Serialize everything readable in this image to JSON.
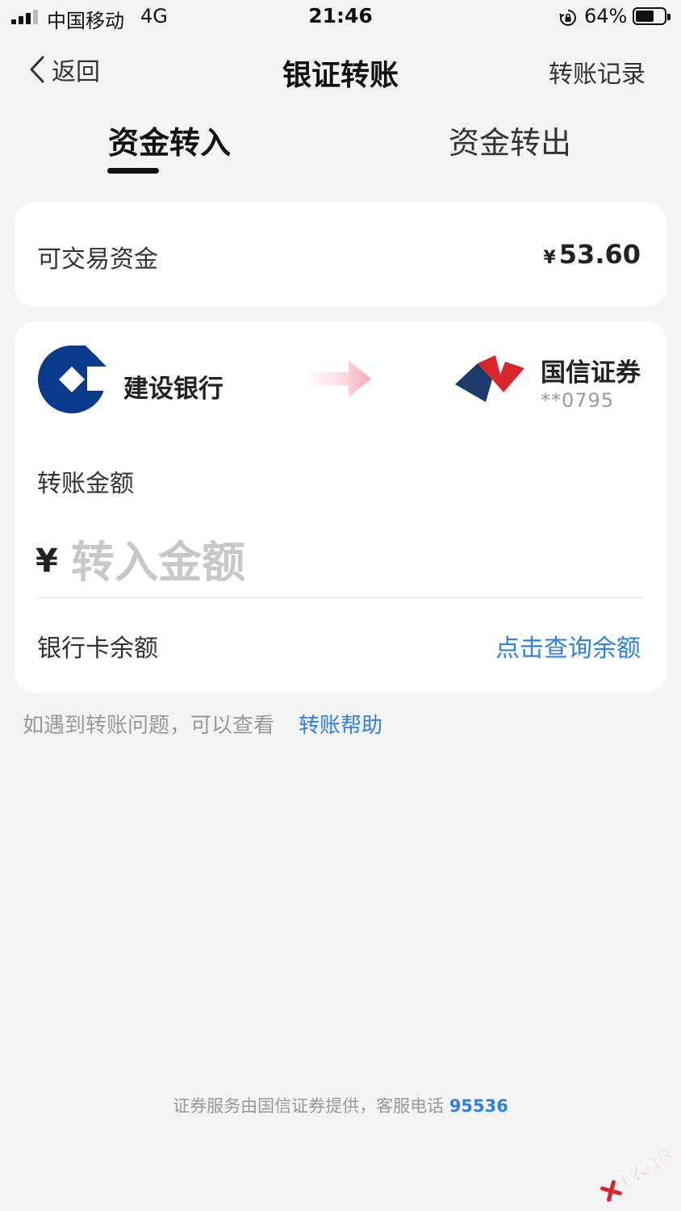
{
  "status_bar": {
    "carrier": "中国移动",
    "network": "4G",
    "time": "21:46",
    "battery": "64%",
    "battery_level": 0.64,
    "icons": [
      "signal-icon",
      "orientation-lock-icon",
      "battery-icon"
    ]
  },
  "nav": {
    "back_label": "返回",
    "title": "银证转账",
    "records_label": "转账记录"
  },
  "tabs": [
    {
      "label": "资金转入",
      "active": true
    },
    {
      "label": "资金转出",
      "active": false
    }
  ],
  "balance": {
    "label": "可交易资金",
    "currency": "¥",
    "amount": "53.60"
  },
  "transfer": {
    "bank_name": "建设银行",
    "broker_name": "国信证券",
    "account": "**0795",
    "amount_label": "转账金额",
    "currency": "¥",
    "amount_placeholder": "转入金额",
    "amount_value": "",
    "card_balance_label": "银行卡余额",
    "query_link": "点击查询余额"
  },
  "help": {
    "text": "如遇到转账问题，可以查看",
    "link": "转账帮助"
  },
  "footer": {
    "text": "证券服务由国信证券提供，客服电话",
    "phone": "95536"
  },
  "watermark": {
    "text": "卡农社区"
  },
  "colors": {
    "accent_blue": "#2e7fe6",
    "ccb_blue": "#0a3a8c",
    "broker_red": "#d8262c",
    "broker_navy": "#1d3a6b",
    "background": "#f4f4f4"
  }
}
